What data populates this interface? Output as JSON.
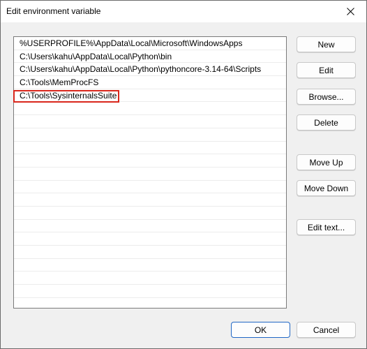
{
  "window": {
    "title": "Edit environment variable"
  },
  "list": {
    "items": [
      "%USERPROFILE%\\AppData\\Local\\Microsoft\\WindowsApps",
      "C:\\Users\\kahu\\AppData\\Local\\Python\\bin",
      "C:\\Users\\kahu\\AppData\\Local\\Python\\pythoncore-3.14-64\\Scripts",
      "C:\\Tools\\MemProcFS",
      "C:\\Tools\\SysinternalsSuite",
      "",
      "",
      "",
      "",
      "",
      "",
      "",
      "",
      "",
      "",
      "",
      "",
      "",
      "",
      "",
      ""
    ],
    "highlighted_item": "C:\\Tools\\SysinternalsSuite"
  },
  "buttons": {
    "new": "New",
    "edit": "Edit",
    "browse": "Browse...",
    "delete": "Delete",
    "move_up": "Move Up",
    "move_down": "Move Down",
    "edit_text": "Edit text...",
    "ok": "OK",
    "cancel": "Cancel"
  },
  "colors": {
    "highlight_border": "#d9261c",
    "primary_button_border": "#1f66c4"
  },
  "icons": {
    "close": "close-icon"
  }
}
